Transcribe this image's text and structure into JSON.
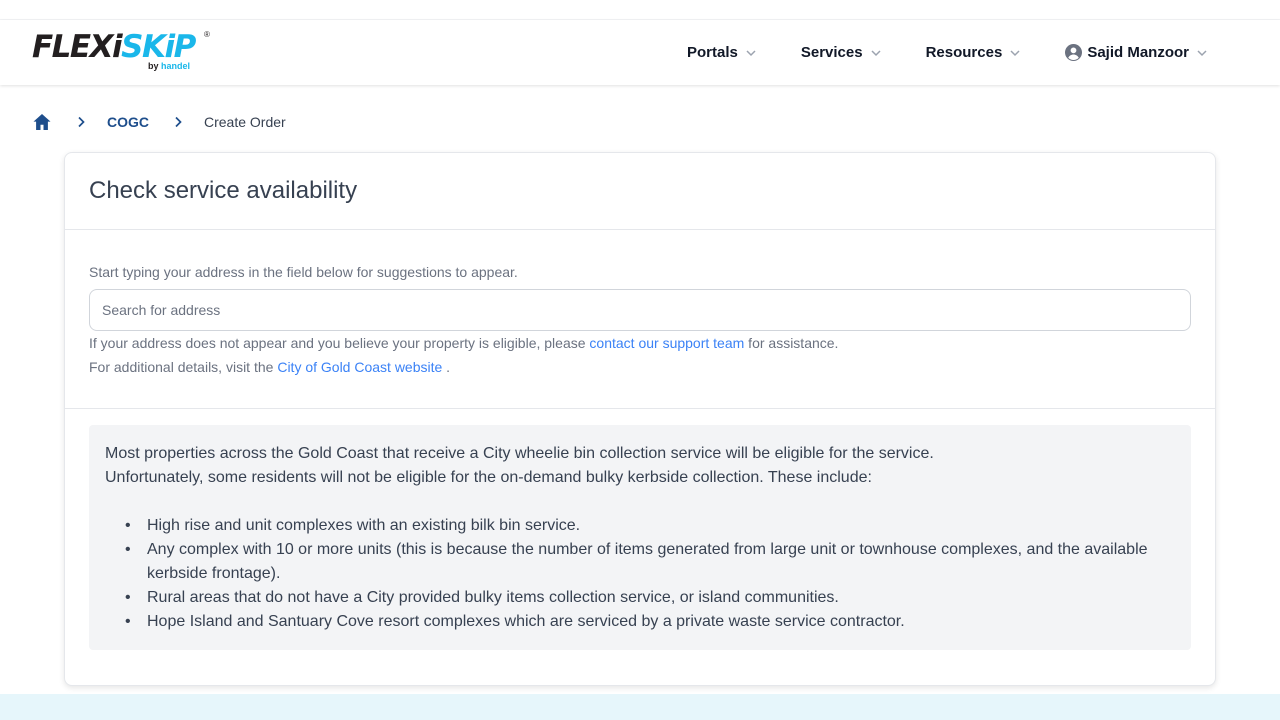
{
  "logo": {
    "brand_a": "FLEXi",
    "brand_b": "SKiP",
    "reg": "®",
    "by_prefix": "by ",
    "by_brand": "handel",
    "colors": {
      "dark": "#231f20",
      "accent": "#1ab7ea"
    }
  },
  "nav": {
    "items": [
      {
        "label": "Portals",
        "icon": "chevron-down-icon"
      },
      {
        "label": "Services",
        "icon": "chevron-down-icon"
      },
      {
        "label": "Resources",
        "icon": "chevron-down-icon"
      }
    ],
    "user": {
      "name": "Sajid Manzoor",
      "icon": "user-circle-icon"
    }
  },
  "breadcrumb": {
    "home_icon": "home-icon",
    "items": [
      {
        "label": "COGC"
      },
      {
        "label": "Create Order"
      }
    ]
  },
  "card": {
    "title": "Check service availability",
    "hint": "Start typing your address in the field below for suggestions to appear.",
    "search": {
      "placeholder": "Search for address",
      "value": ""
    },
    "help1": {
      "before": "If your address does not appear and you believe your property is eligible, please ",
      "link": "contact our support team",
      "after": " for assistance."
    },
    "help2": {
      "before": "For additional details, visit the ",
      "link": "City of Gold Coast website",
      "after": " ."
    }
  },
  "info": {
    "line1": "Most properties across the Gold Coast that receive a City wheelie bin collection service will be eligible for the service.",
    "line2": "Unfortunately, some residents will not be eligible for the on-demand bulky kerbside collection. These include:",
    "items": [
      "High rise and unit complexes with an existing bilk bin service.",
      "Any complex with 10 or more units (this is because the number of items generated from large unit or townhouse complexes, and the available kerbside frontage).",
      "Rural areas that do not have a City provided bulky items collection service, or island communities.",
      "Hope Island and Santuary Cove resort complexes which are serviced by a private waste service contractor."
    ]
  },
  "colors": {
    "link": "#3b82f6",
    "breadcrumb_link": "#1e4e8c",
    "info_bg": "#f3f4f6"
  }
}
